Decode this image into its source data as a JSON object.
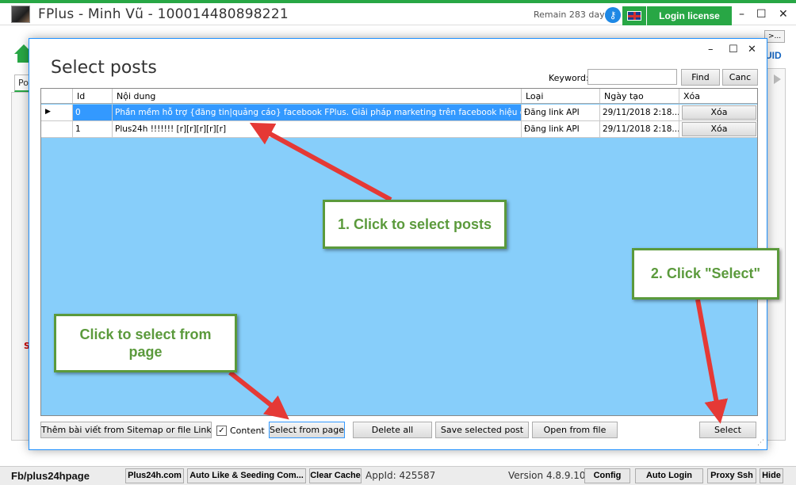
{
  "app": {
    "title": "FPlus - Minh Vũ - 100014480898221",
    "remain": "Remain 283 days",
    "login_label": "Login license",
    "minimize": "–",
    "maximize": "☐",
    "close": "✕",
    "small_btn": ">...",
    "uid_label": "UID",
    "tab_po": "Po",
    "red_mark": "S",
    "accent_color": "#28a745"
  },
  "dialog": {
    "title": "Select posts",
    "keyword_label": "Keyword:",
    "keyword_value": "",
    "find_label": "Find",
    "cancel_label": "Canc",
    "minimize": "–",
    "maximize": "☐",
    "close": "✕",
    "columns": [
      "Id",
      "Nội dung",
      "Loại",
      "Ngày tạo",
      "Xóa"
    ],
    "rows": [
      {
        "marker": "▶",
        "id": "0",
        "content": "Phần mềm hỗ trợ {đăng tin|quảng cáo} facebook FPlus. Giải pháp marketing trên facebook hiệu quả. [r][r]...",
        "type": "Đăng link API",
        "date": "29/11/2018 2:18...",
        "delete_label": "Xóa",
        "selected": true
      },
      {
        "marker": "",
        "id": "1",
        "content": "Plus24h !!!!!!! [r][r][r][r][r]",
        "type": "Đăng link API",
        "date": "29/11/2018 2:18...",
        "delete_label": "Xóa",
        "selected": false
      }
    ],
    "add_sitemap_label": "Thêm bài viết from Sitemap or file Link (txt)",
    "content_checkbox_label": "Content",
    "content_checked": true,
    "select_from_page_label": "Select from page",
    "delete_all_label": "Delete all",
    "save_selected_label": "Save selected post",
    "open_file_label": "Open from file",
    "select_label": "Select"
  },
  "callouts": {
    "select_posts": "1. Click to select posts",
    "click_select": "2. Click \"Select\"",
    "from_page": "Click to select from page",
    "color": "#5b9a3c",
    "arrow_color": "#e53935"
  },
  "status": {
    "page": "Fb/plus24hpage",
    "plus24h": "Plus24h.com",
    "auto_like": "Auto Like & Seeding Com...",
    "clear_cache": "Clear Cache",
    "app_id": "AppId: 425587",
    "version": "Version 4.8.9.10",
    "config": "Config",
    "auto_login": "Auto Login",
    "proxy": "Proxy Ssh",
    "hide": "Hide"
  }
}
